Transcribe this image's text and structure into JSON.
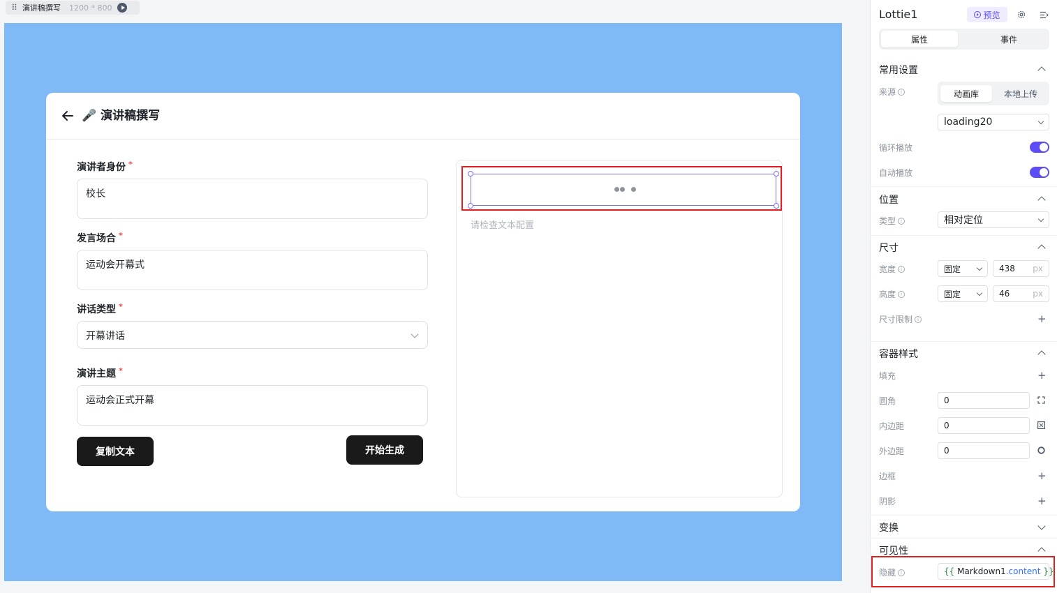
{
  "frame_tab": {
    "name": "演讲稿撰写",
    "size": "1200 * 800"
  },
  "app": {
    "header_emoji": "🎤",
    "title": "演讲稿撰写",
    "fields": [
      {
        "label": "演讲者身份",
        "required_mark": "*",
        "value": "校长"
      },
      {
        "label": "发言场合",
        "required_mark": "*",
        "value": "运动会开幕式"
      },
      {
        "label": "讲话类型",
        "required_mark": "*",
        "value": "开幕讲话"
      },
      {
        "label": "演讲主题",
        "required_mark": "*",
        "value": "运动会正式开幕"
      }
    ],
    "copy_button": "复制文本",
    "generate_button": "开始生成",
    "preview_hint": "请检查文本配置"
  },
  "panel": {
    "component_name": "Lottie1",
    "preview_label": "预览",
    "tabs": [
      "属性",
      "事件"
    ],
    "sections": {
      "common": "常用设置",
      "position": "位置",
      "size": "尺寸",
      "container_style": "容器样式",
      "transform": "变换",
      "visibility": "可见性"
    },
    "source": {
      "label": "来源",
      "options": [
        "动画库",
        "本地上传"
      ],
      "selected": "loading20"
    },
    "loop": {
      "label": "循环播放",
      "on": true
    },
    "autoplay": {
      "label": "自动播放",
      "on": true
    },
    "position_type": {
      "label": "类型",
      "value": "相对定位"
    },
    "width": {
      "label": "宽度",
      "mode": "固定",
      "value": "438",
      "unit": "px"
    },
    "height": {
      "label": "高度",
      "mode": "固定",
      "value": "46",
      "unit": "px"
    },
    "size_limit": {
      "label": "尺寸限制"
    },
    "fill": {
      "label": "填充"
    },
    "radius": {
      "label": "圆角",
      "value": "0"
    },
    "padding": {
      "label": "内边距",
      "value": "0"
    },
    "margin": {
      "label": "外边距",
      "value": "0"
    },
    "border": {
      "label": "边框"
    },
    "shadow": {
      "label": "阴影"
    },
    "hidden": {
      "label": "隐藏",
      "open": "{{",
      "var": "Markdown1",
      "prop": ".content",
      "close": "}}"
    }
  }
}
